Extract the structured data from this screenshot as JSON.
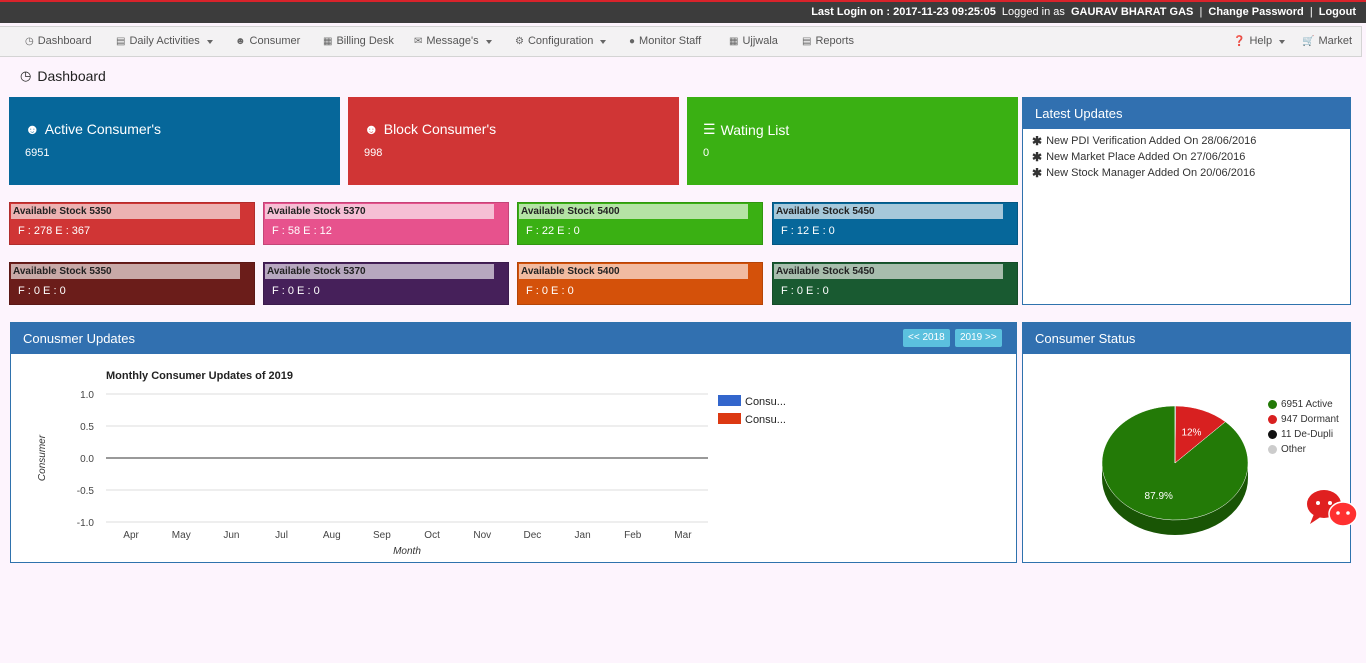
{
  "topbar": {
    "login_prefix": "Last Login on : 2017-11-23 09:25:05",
    "logged_as": "Logged in as",
    "user": "GAURAV BHARAT GAS",
    "change_password": "Change Password",
    "logout": "Logout"
  },
  "nav": {
    "dashboard": "Dashboard",
    "daily_activities": "Daily Activities",
    "consumer": "Consumer",
    "billing_desk": "Billing Desk",
    "messages": "Message's",
    "configuration": "Configuration",
    "monitor_staff": "Monitor Staff",
    "ujjwala": "Ujjwala",
    "reports": "Reports",
    "help": "Help",
    "market": "Market"
  },
  "page_title": "Dashboard",
  "cards": {
    "active": {
      "title": "Active Consumer's",
      "value": "6951",
      "color": "#06679a"
    },
    "block": {
      "title": "Block Consumer's",
      "value": "998",
      "color": "#d03535"
    },
    "waiting": {
      "title": "Wating List",
      "value": "0",
      "color": "#3ab013"
    }
  },
  "stocks": [
    {
      "label": "Available Stock 5350",
      "value": "F : 278 E : 367",
      "bg": "#d03535",
      "bar": "#ecb2b2"
    },
    {
      "label": "Available Stock 5370",
      "value": "F : 58 E : 12",
      "bg": "#e7528d",
      "bar": "#f6bfd5"
    },
    {
      "label": "Available Stock 5400",
      "value": "F : 22 E : 0",
      "bg": "#3ab013",
      "bar": "#b5e3a5"
    },
    {
      "label": "Available Stock 5450",
      "value": "F : 12 E : 0",
      "bg": "#06679a",
      "bar": "#a6c8da"
    },
    {
      "label": "Available Stock 5350",
      "value": "F : 0 E : 0",
      "bg": "#6b1d1a",
      "bar": "#c8a9a7"
    },
    {
      "label": "Available Stock 5370",
      "value": "F : 0 E : 0",
      "bg": "#46205a",
      "bar": "#b7a7bf"
    },
    {
      "label": "Available Stock 5400",
      "value": "F : 0 E : 0",
      "bg": "#d4510a",
      "bar": "#f1bba0"
    },
    {
      "label": "Available Stock 5450",
      "value": "F : 0 E : 0",
      "bg": "#195a31",
      "bar": "#a7bdad"
    }
  ],
  "latest_updates": {
    "title": "Latest Updates",
    "items": [
      "New PDI Verification Added On 28/06/2016",
      "New Market Place Added On 27/06/2016",
      "New Stock Manager Added On 20/06/2016"
    ]
  },
  "consumer_updates": {
    "title": "Conusmer Updates",
    "prev_year": "<< 2018",
    "next_year": "2019 >>"
  },
  "consumer_status": {
    "title": "Consumer Status",
    "legend": [
      {
        "label": "6951 Active",
        "color": "#237a07"
      },
      {
        "label": "947 Dormant",
        "color": "#d82020"
      },
      {
        "label": "11 De-Dupli",
        "color": "#111111"
      },
      {
        "label": "Other",
        "color": "#cccccc"
      }
    ]
  },
  "chart_data": [
    {
      "type": "line",
      "title": "Monthly Consumer Updates of 2019",
      "xlabel": "Month",
      "ylabel": "Consumer",
      "categories": [
        "Apr",
        "May",
        "Jun",
        "Jul",
        "Aug",
        "Sep",
        "Oct",
        "Nov",
        "Dec",
        "Jan",
        "Feb",
        "Mar"
      ],
      "ylim": [
        -1.0,
        1.0
      ],
      "yticks": [
        "1.0",
        "0.5",
        "0.0",
        "-0.5",
        "-1.0"
      ],
      "series": [
        {
          "name": "Consu...",
          "color": "#3366cc",
          "values": [
            0,
            0,
            0,
            0,
            0,
            0,
            0,
            0,
            0,
            0,
            0,
            0
          ]
        },
        {
          "name": "Consu...",
          "color": "#dc3912",
          "values": [
            0,
            0,
            0,
            0,
            0,
            0,
            0,
            0,
            0,
            0,
            0,
            0
          ]
        }
      ],
      "grid": true,
      "legend": "right"
    },
    {
      "type": "pie",
      "labels": [
        "Active",
        "Dormant",
        "De-Dupli",
        "Other"
      ],
      "values": [
        6951,
        947,
        11,
        0
      ],
      "slice_labels": [
        "87.9%",
        "12%"
      ],
      "colors": [
        "#237a07",
        "#d82020",
        "#111111",
        "#cccccc"
      ],
      "legend": "right"
    }
  ]
}
